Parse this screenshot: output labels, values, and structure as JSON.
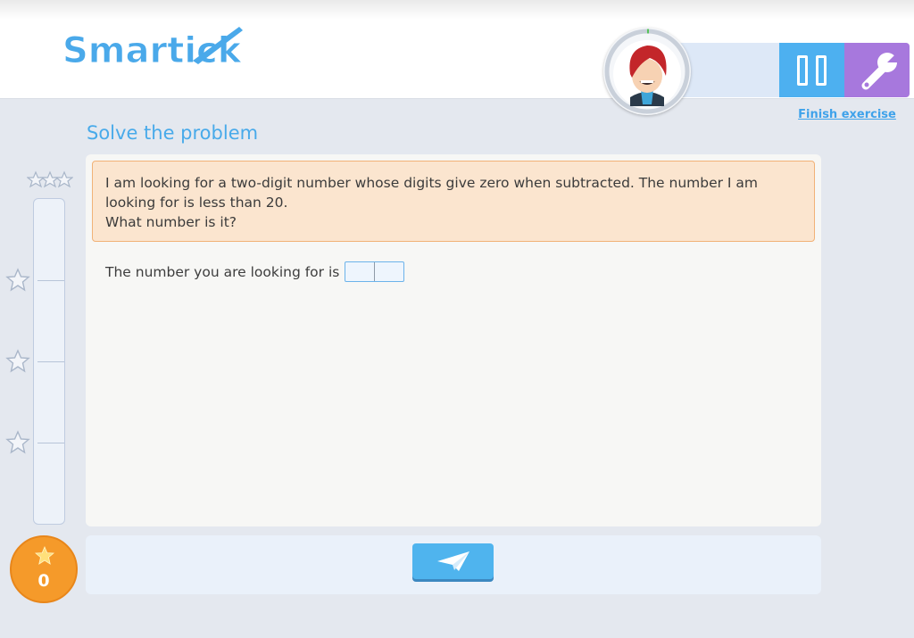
{
  "header": {
    "logo_text": "Smartick",
    "finish_label": "Finish exercise"
  },
  "exercise": {
    "title": "Solve the problem",
    "problem_lines": [
      "I am looking for a two-digit number whose digits give zero when subtracted. The number I am",
      "looking for is less than 20.",
      "What number is it?"
    ],
    "answer_prompt": "The number you are looking for is",
    "answer_digits": [
      "",
      ""
    ]
  },
  "progress": {
    "score": "0",
    "level_fraction": 0,
    "star_levels": 3
  },
  "icons": {
    "pause": "pause-icon",
    "settings": "wrench-icon",
    "send": "paper-plane-icon",
    "star": "star-icon",
    "avatar": "avatar-face"
  },
  "colors": {
    "accent_blue": "#4db0f0",
    "settings_purple": "#a778dd",
    "problem_bg": "#fbe5cf",
    "score_orange": "#f59a2a",
    "title_blue": "#48aaea"
  }
}
